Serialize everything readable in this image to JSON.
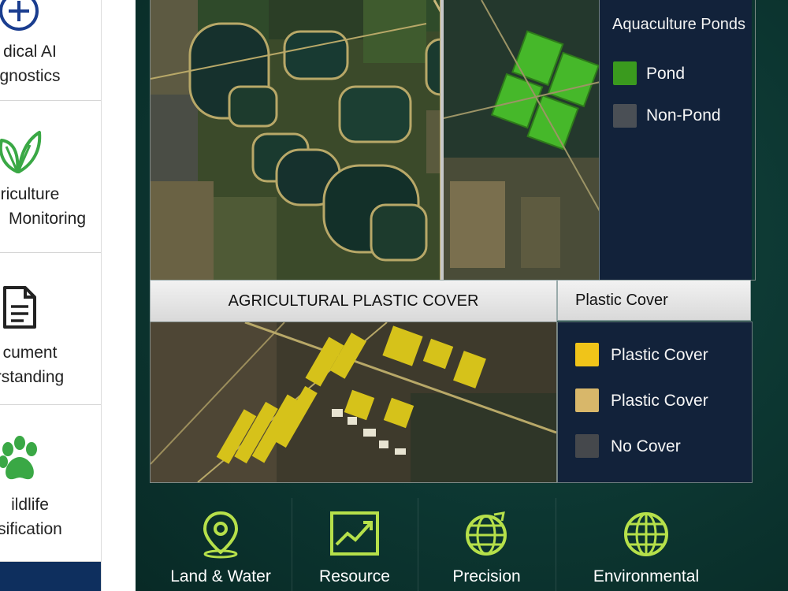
{
  "sidebar": {
    "items": [
      {
        "label_line1": "dical AI",
        "label_line2": "gnostics",
        "icon": "plus-circle-icon",
        "icon_color": "#1a3d8f"
      },
      {
        "label_line1": "riculture",
        "label_line2": "Monitoring",
        "icon": "leaf-icon",
        "icon_color": "#3aa845"
      },
      {
        "label_line1": "cument",
        "label_line2": "rstanding",
        "icon": "document-icon",
        "icon_color": "#222222"
      },
      {
        "label_line1": "ildlife",
        "label_line2": "sification",
        "icon": "paw-icon",
        "icon_color": "#3aa845"
      }
    ]
  },
  "aquaculture": {
    "legend_title": "Aquaculture Ponds",
    "legend": [
      {
        "label": "Pond",
        "color": "#3a9a1e"
      },
      {
        "label": "Non-Pond",
        "color": "#4a4f55"
      }
    ]
  },
  "plastic": {
    "band_title": "AGRICULTURAL PLASTIC COVER",
    "legend_title": "Plastic Cover",
    "legend": [
      {
        "label": "Plastic Cover",
        "color": "#f0c419"
      },
      {
        "label": "Plastic Cover",
        "color": "#d8b76a"
      },
      {
        "label": "No Cover",
        "color": "#45484c"
      }
    ]
  },
  "features": [
    {
      "label": "Land & Water",
      "icon": "location-pin-icon"
    },
    {
      "label": "Resource",
      "icon": "line-chart-icon"
    },
    {
      "label": "Precision",
      "icon": "globe-icon"
    },
    {
      "label": "Environmental",
      "icon": "globe-icon"
    }
  ],
  "colors": {
    "accent_green": "#b6e04a",
    "panel_bg": "#0c3530",
    "sidebar_bottom": "#0e2f5e"
  }
}
